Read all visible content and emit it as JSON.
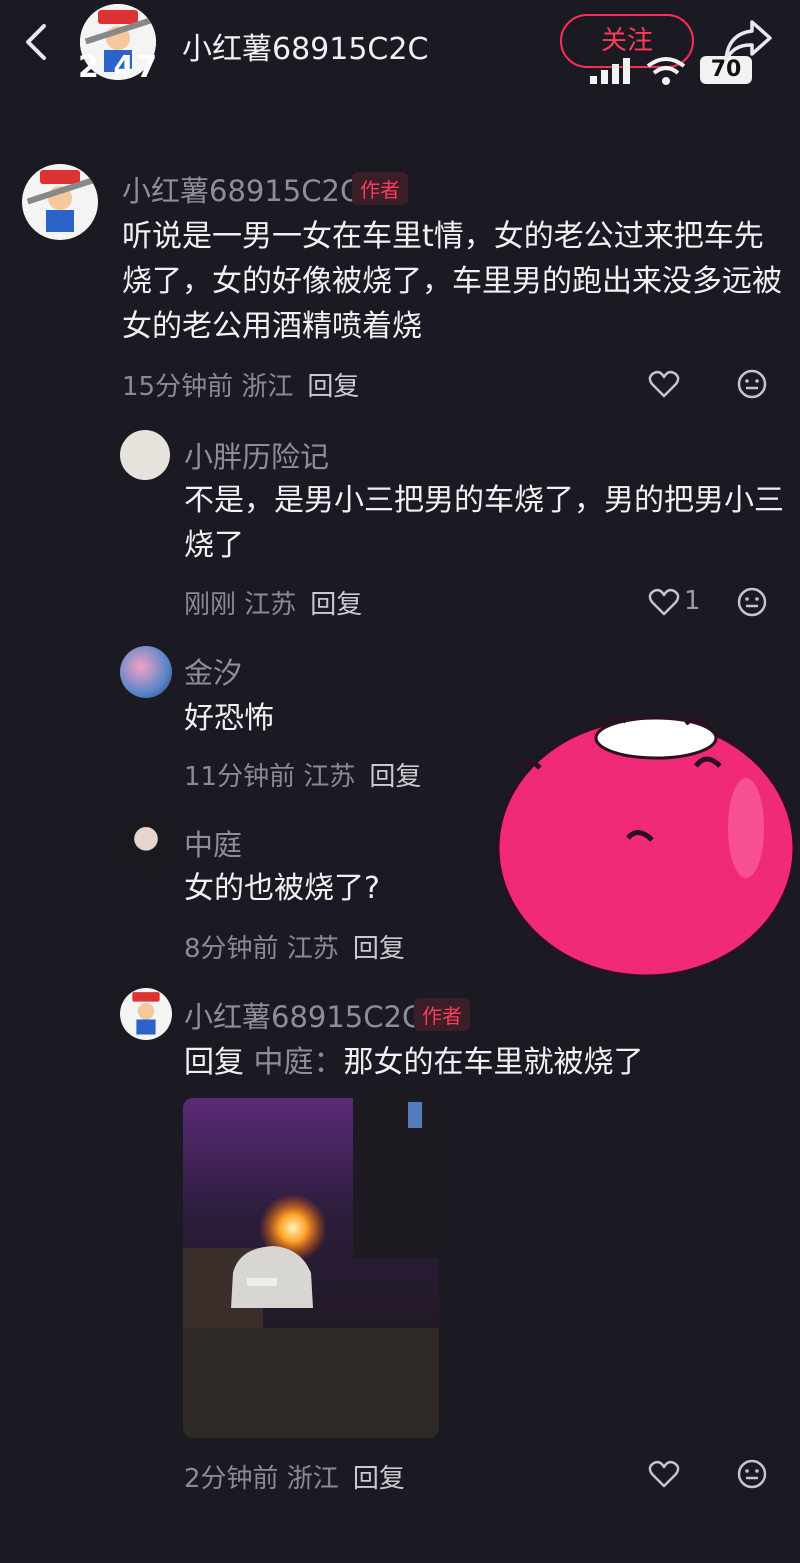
{
  "header": {
    "back_icon": "chevron-left-icon",
    "title": "小红薯68915C2C",
    "status_time": "2  47",
    "follow_label": "关注",
    "battery": "70",
    "share_icon": "share-arrow-icon"
  },
  "comments": [
    {
      "user": "小红薯68915C2C",
      "tag": "作者",
      "text": "听说是一男一女在车里t情，女的老公过来把车先烧了，女的好像被烧了，车里男的跑出来没多远被女的老公用酒精喷着烧",
      "time": "15分钟前 浙江",
      "reply_label": "回复"
    },
    {
      "user": "小胖历险记",
      "text": "不是，是男小三把男的车烧了，男的把男小三烧了",
      "time": "刚刚 江苏",
      "reply_label": "回复",
      "likes": "1"
    },
    {
      "user": "金汐",
      "text": "好恐怖",
      "time": "11分钟前 江苏",
      "reply_label": "回复"
    },
    {
      "user": "中庭",
      "text": "女的也被烧了?",
      "time": "8分钟前 江苏",
      "reply_label": "回复"
    },
    {
      "user": "小红薯68915C2C",
      "tag": "作者",
      "reply_prefix": "回复",
      "reply_to": "中庭：",
      "text": "那女的在车里就被烧了",
      "time": "2分钟前 浙江",
      "reply_label": "回复"
    }
  ],
  "colors": {
    "background": "#1b1a22",
    "accent": "#ff2d55",
    "muted": "#8a8a93"
  }
}
